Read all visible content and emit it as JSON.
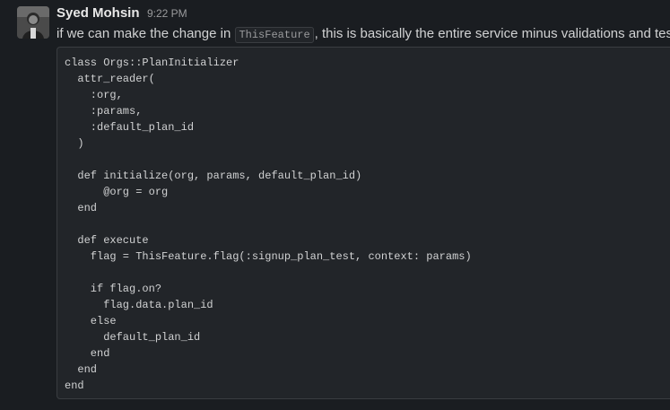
{
  "message": {
    "author": "Syed Mohsin",
    "time": "9:22 PM",
    "text_before": "if we can make the change in ",
    "inline_code": "ThisFeature",
    "text_after": ", this is basically the entire service minus validations and tests",
    "code_lines": [
      "class Orgs::PlanInitializer",
      "  attr_reader(",
      "    :org,",
      "    :params,",
      "    :default_plan_id",
      "  )",
      "",
      "  def initialize(org, params, default_plan_id)",
      "      @org = org",
      "  end",
      "",
      "  def execute",
      "    flag = ThisFeature.flag(:signup_plan_test, context: params)",
      "",
      "    if flag.on?",
      "      flag.data.plan_id",
      "    else",
      "      default_plan_id",
      "    end",
      "  end",
      "end"
    ]
  }
}
